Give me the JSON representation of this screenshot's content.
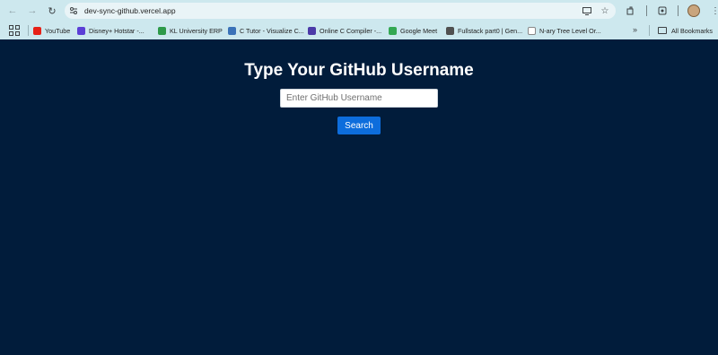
{
  "browser": {
    "url": "dev-sync-github.vercel.app",
    "bookmarks": [
      {
        "label": "YouTube",
        "color": "#e62117"
      },
      {
        "label": "Disney+ Hotstar -...",
        "color": "#5b3fd6"
      },
      {
        "label": "KL University ERP",
        "color": "#2e9a4a"
      },
      {
        "label": "C Tutor - Visualize C...",
        "color": "#3a72b8"
      },
      {
        "label": "Online C Compiler -...",
        "color": "#4b3aa8"
      },
      {
        "label": "Google Meet",
        "color": "#34a853"
      },
      {
        "label": "Fullstack part0 | Gen...",
        "color": "#505050"
      },
      {
        "label": "N-ary Tree Level Or...",
        "color": "#ffffff"
      }
    ],
    "all_bookmarks_label": "All Bookmarks"
  },
  "page": {
    "title": "Type Your GitHub Username",
    "input_placeholder": "Enter GitHub Username",
    "input_value": "",
    "search_label": "Search"
  },
  "colors": {
    "background": "#011c3b",
    "button": "#0d6ddc",
    "chrome_bar": "#cde8ee"
  }
}
